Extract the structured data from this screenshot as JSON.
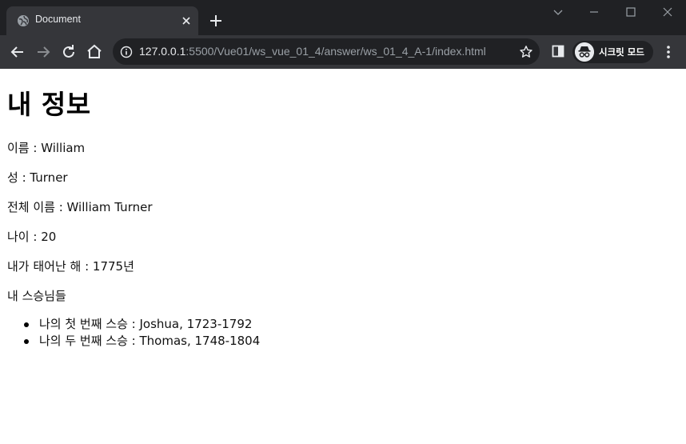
{
  "browser": {
    "tab_title": "Document",
    "url_host": "127.0.0.1",
    "url_path": ":5500/Vue01/ws_vue_01_4/answer/ws_01_4_A-1/index.html",
    "incognito_label": "시크릿 모드",
    "colors": {
      "tabstrip": "#202124",
      "toolbar": "#35363a",
      "omnibox": "#202124"
    }
  },
  "page": {
    "heading": "내 정보",
    "first_name": "이름 : William",
    "last_name": "성 : Turner",
    "full_name": "전체 이름 : William Turner",
    "age": "나이 : 20",
    "birth_year": "내가 태어난 해 : 1775년",
    "mentors_title": "내 스승님들",
    "mentors": [
      "나의 첫 번째 스승 : Joshua, 1723-1792",
      "나의 두 번째 스승 : Thomas, 1748-1804"
    ]
  }
}
